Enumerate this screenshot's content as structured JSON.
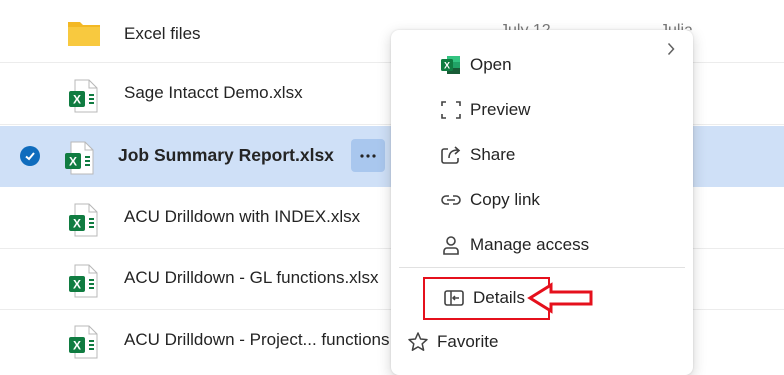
{
  "files": [
    {
      "name": "Excel files",
      "type": "folder",
      "modified": "July 12",
      "owner": "Julia",
      "selected": false
    },
    {
      "name": "Sage Intacct Demo.xlsx",
      "type": "excel",
      "selected": false
    },
    {
      "name": "Job Summary Report.xlsx",
      "type": "excel",
      "selected": true
    },
    {
      "name": "ACU Drilldown with INDEX.xlsx",
      "type": "excel",
      "selected": false
    },
    {
      "name": "ACU Drilldown - GL functions.xlsx",
      "type": "excel",
      "selected": false
    },
    {
      "name": "ACU Drilldown - Project... functions",
      "type": "excel",
      "selected": false
    }
  ],
  "context_menu": {
    "items": [
      {
        "label": "Open",
        "icon": "excel-icon",
        "has_submenu": true
      },
      {
        "label": "Preview",
        "icon": "preview-icon"
      },
      {
        "label": "Share",
        "icon": "share-icon"
      },
      {
        "label": "Copy link",
        "icon": "link-icon"
      },
      {
        "label": "Manage access",
        "icon": "person-icon"
      },
      {
        "label": "Details",
        "icon": "details-icon",
        "highlighted": true
      },
      {
        "label": "Favorite",
        "icon": "star-icon"
      }
    ]
  },
  "colors": {
    "selection": "#cfe0f7",
    "accent": "#0f6cbd",
    "excel_green": "#107c41",
    "folder_yellow": "#f8c93f",
    "annotation_red": "#e5101c"
  }
}
